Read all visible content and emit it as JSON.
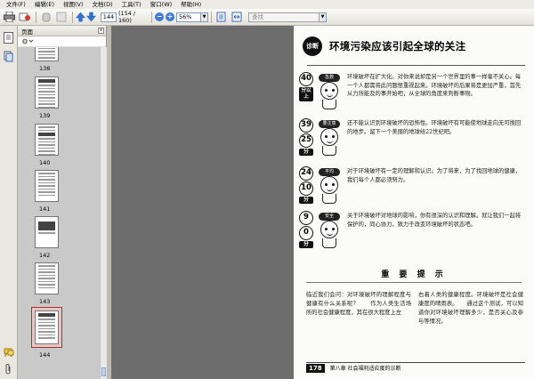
{
  "menubar": {
    "items": [
      "文件(F)",
      "编辑(E)",
      "视图(V)",
      "文档(D)",
      "工具(T)",
      "窗口(W)",
      "帮助(H)"
    ]
  },
  "toolbar": {
    "page_input": "144",
    "page_count": "(154 / 160)",
    "zoom": "56%",
    "search_placeholder": "查找"
  },
  "panel": {
    "title": "页面",
    "thumbnails": [
      {
        "label": "138"
      },
      {
        "label": "139"
      },
      {
        "label": "140"
      },
      {
        "label": "141"
      },
      {
        "label": "142"
      },
      {
        "label": "143"
      },
      {
        "label": "144"
      }
    ]
  },
  "document": {
    "header_badge": "诊断",
    "header_title": "环境污染应该引起全球的关注",
    "rows": [
      {
        "score": "40",
        "unit": "分以上",
        "tag": "急救",
        "text": "环境破坏在扩大化。对你来说却是另一个世界里的事一样毫不关心。每一个人都需将此问题恨重视起来。环境破坏的后果将是更加严重，首先从力所能及的事开始吧，从全球的角度来判断事物。"
      },
      {
        "score": "39",
        "score2": "25",
        "unit": "分",
        "tag": "要注意",
        "text": "还不能认识到环境破坏的恐怖性。环境破坏有可能使地球走向无可挽回的地步。留下一个美丽的地球给22世纪吧。"
      },
      {
        "score": "24",
        "score2": "10",
        "unit": "分",
        "tag": "平均",
        "text": "对于环境破坏有一定的理解和认识。为了将来，为了找回地球的健康，我们每个人都必须努力。"
      },
      {
        "score": "9",
        "score2": "0",
        "unit": "分",
        "tag": "安全",
        "text": "关于环境破坏对地球的影响，你有很深的认识和理解。就让我们一起将保护的，同心协力，致力于改变环境破坏的状态吧。"
      }
    ],
    "section_title": "重 要 提 示",
    "col1": "临近我们会问：对环境破坏的理解程度与健康有什么关系呢？　　作为人类生活场所的社会健康程度，其在很大程度上左",
    "col2": "右着人类的健康程度。环境破坏是社会健康度的晴雨表。　　通过这个测试，可以知道你对环境破坏理解多少，是否关心及参与等情况。",
    "footer_page": "178",
    "footer_text": "第八章  社会福利适应度的诊断"
  }
}
